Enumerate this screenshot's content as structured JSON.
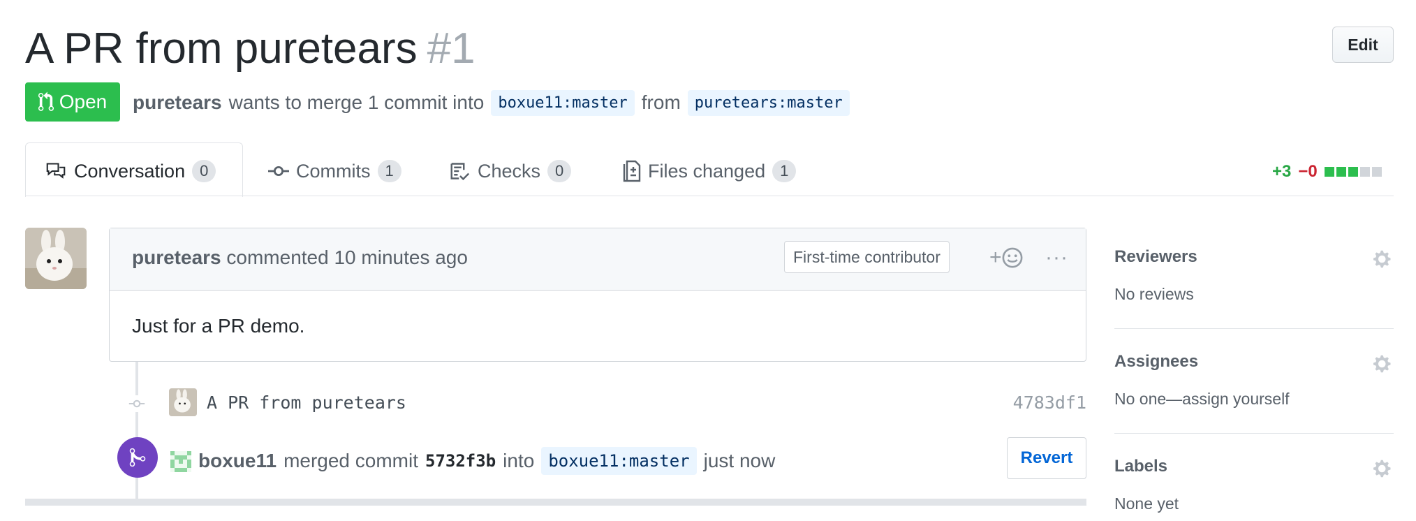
{
  "pr": {
    "title": "A PR from puretears",
    "number": "#1",
    "edit_label": "Edit",
    "state": "Open",
    "author": "puretears",
    "merge_text": "wants to merge 1 commit into",
    "base_branch": "boxue11:master",
    "from_text": "from",
    "head_branch": "puretears:master"
  },
  "tabs": [
    {
      "label": "Conversation",
      "count": "0",
      "icon": "comment-discussion-icon"
    },
    {
      "label": "Commits",
      "count": "1",
      "icon": "git-commit-icon"
    },
    {
      "label": "Checks",
      "count": "0",
      "icon": "checklist-icon"
    },
    {
      "label": "Files changed",
      "count": "1",
      "icon": "file-diff-icon"
    }
  ],
  "diffstat": {
    "additions": "+3",
    "deletions": "−0"
  },
  "comment": {
    "author": "puretears",
    "action": "commented 10 minutes ago",
    "badge": "First-time contributor",
    "reaction": "+",
    "more": "···",
    "body": "Just for a PR demo."
  },
  "commit": {
    "message": "A PR from puretears",
    "sha": "4783df1"
  },
  "merge_event": {
    "actor": "boxue11",
    "text": "merged commit",
    "sha": "5732f3b",
    "into": "into",
    "branch": "boxue11:master",
    "time": "just now",
    "revert_label": "Revert"
  },
  "sidebar": {
    "reviewers": {
      "title": "Reviewers",
      "value": "No reviews"
    },
    "assignees": {
      "title": "Assignees",
      "value": "No one—assign yourself"
    },
    "labels": {
      "title": "Labels",
      "value": "None yet"
    }
  },
  "colors": {
    "open_green": "#2cbe4e",
    "merge_purple": "#6f42c1",
    "link_blue": "#0366d6",
    "branch_bg": "#eaf5ff"
  }
}
